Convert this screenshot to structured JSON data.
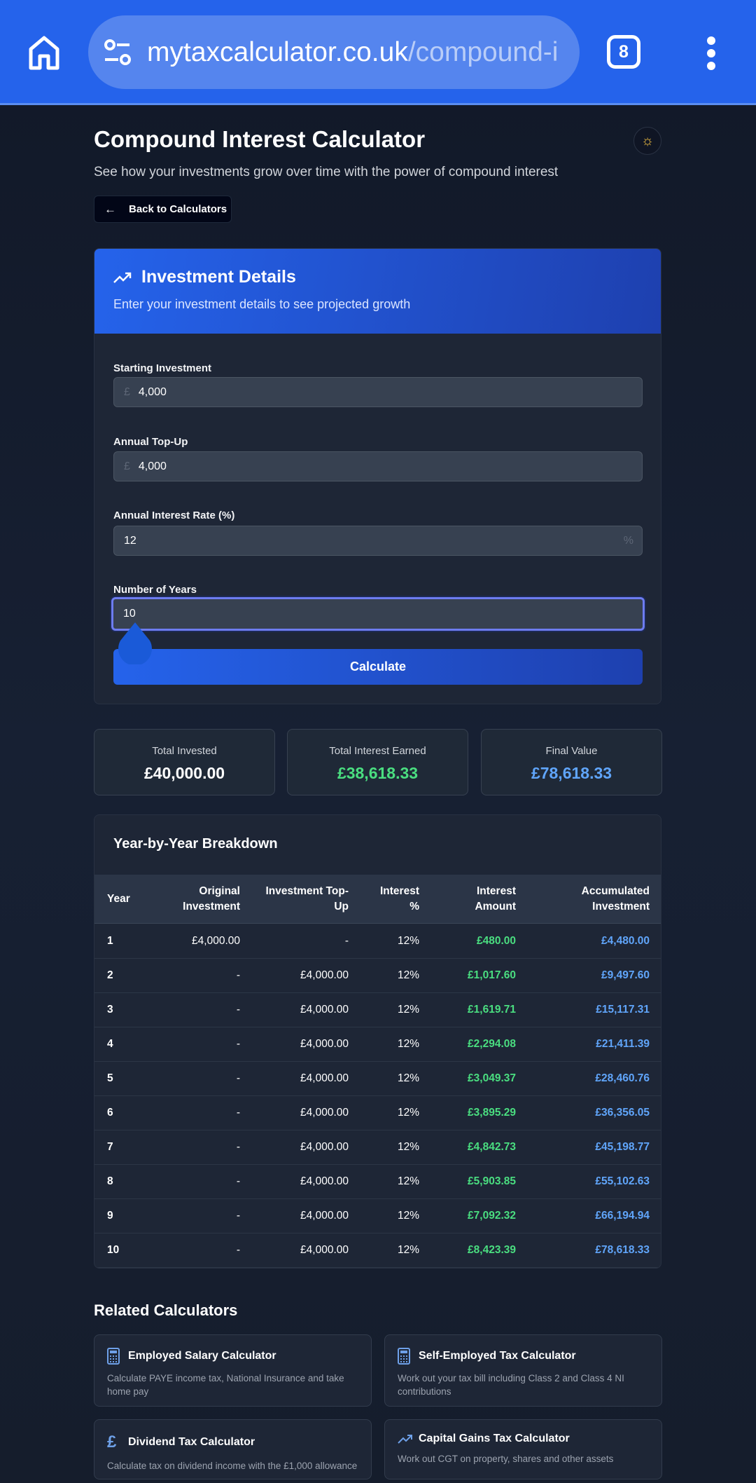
{
  "browser": {
    "url_domain": "mytaxcalculator.co.uk",
    "url_path": "/compound-i",
    "tab_count": "8"
  },
  "page": {
    "title": "Compound Interest Calculator",
    "subtitle": "See how your investments grow over time with the power of compound interest",
    "back_label": "Back to Calculators"
  },
  "form": {
    "title": "Investment Details",
    "description": "Enter your investment details to see projected growth",
    "currency_symbol": "£",
    "percent_symbol": "%",
    "starting_label": "Starting Investment",
    "starting_value": "4,000",
    "topup_label": "Annual Top-Up",
    "topup_value": "4,000",
    "rate_label": "Annual Interest Rate (%)",
    "rate_value": "12",
    "years_label": "Number of Years",
    "years_value": "10",
    "calculate_label": "Calculate"
  },
  "summary": [
    {
      "label": "Total Invested",
      "value": "£40,000.00"
    },
    {
      "label": "Total Interest Earned",
      "value": "£38,618.33"
    },
    {
      "label": "Final Value",
      "value": "£78,618.33"
    }
  ],
  "table": {
    "title": "Year-by-Year Breakdown",
    "headers": [
      "Year",
      "Original Investment",
      "Investment Top-Up",
      "Interest %",
      "Interest Amount",
      "Accumulated Investment"
    ],
    "rows": [
      [
        "1",
        "£4,000.00",
        "-",
        "12%",
        "£480.00",
        "£4,480.00"
      ],
      [
        "2",
        "-",
        "£4,000.00",
        "12%",
        "£1,017.60",
        "£9,497.60"
      ],
      [
        "3",
        "-",
        "£4,000.00",
        "12%",
        "£1,619.71",
        "£15,117.31"
      ],
      [
        "4",
        "-",
        "£4,000.00",
        "12%",
        "£2,294.08",
        "£21,411.39"
      ],
      [
        "5",
        "-",
        "£4,000.00",
        "12%",
        "£3,049.37",
        "£28,460.76"
      ],
      [
        "6",
        "-",
        "£4,000.00",
        "12%",
        "£3,895.29",
        "£36,356.05"
      ],
      [
        "7",
        "-",
        "£4,000.00",
        "12%",
        "£4,842.73",
        "£45,198.77"
      ],
      [
        "8",
        "-",
        "£4,000.00",
        "12%",
        "£5,903.85",
        "£55,102.63"
      ],
      [
        "9",
        "-",
        "£4,000.00",
        "12%",
        "£7,092.32",
        "£66,194.94"
      ],
      [
        "10",
        "-",
        "£4,000.00",
        "12%",
        "£8,423.39",
        "£78,618.33"
      ]
    ]
  },
  "related": {
    "title": "Related Calculators",
    "items": [
      {
        "title": "Employed Salary Calculator",
        "desc": "Calculate PAYE income tax, National Insurance and take home pay",
        "icon": "calculator-icon"
      },
      {
        "title": "Self-Employed Tax Calculator",
        "desc": "Work out your tax bill including Class 2 and Class 4 NI contributions",
        "icon": "calculator-icon"
      },
      {
        "title": "Dividend Tax Calculator",
        "desc": "Calculate tax on dividend income with the £1,000 allowance",
        "icon": "pound-icon"
      },
      {
        "title": "Capital Gains Tax Calculator",
        "desc": "Work out CGT on property, shares and other assets",
        "icon": "trending-up-icon"
      }
    ]
  },
  "colors": {
    "accent": "#2563eb",
    "green": "#4ade80",
    "blue": "#60a5fa"
  }
}
